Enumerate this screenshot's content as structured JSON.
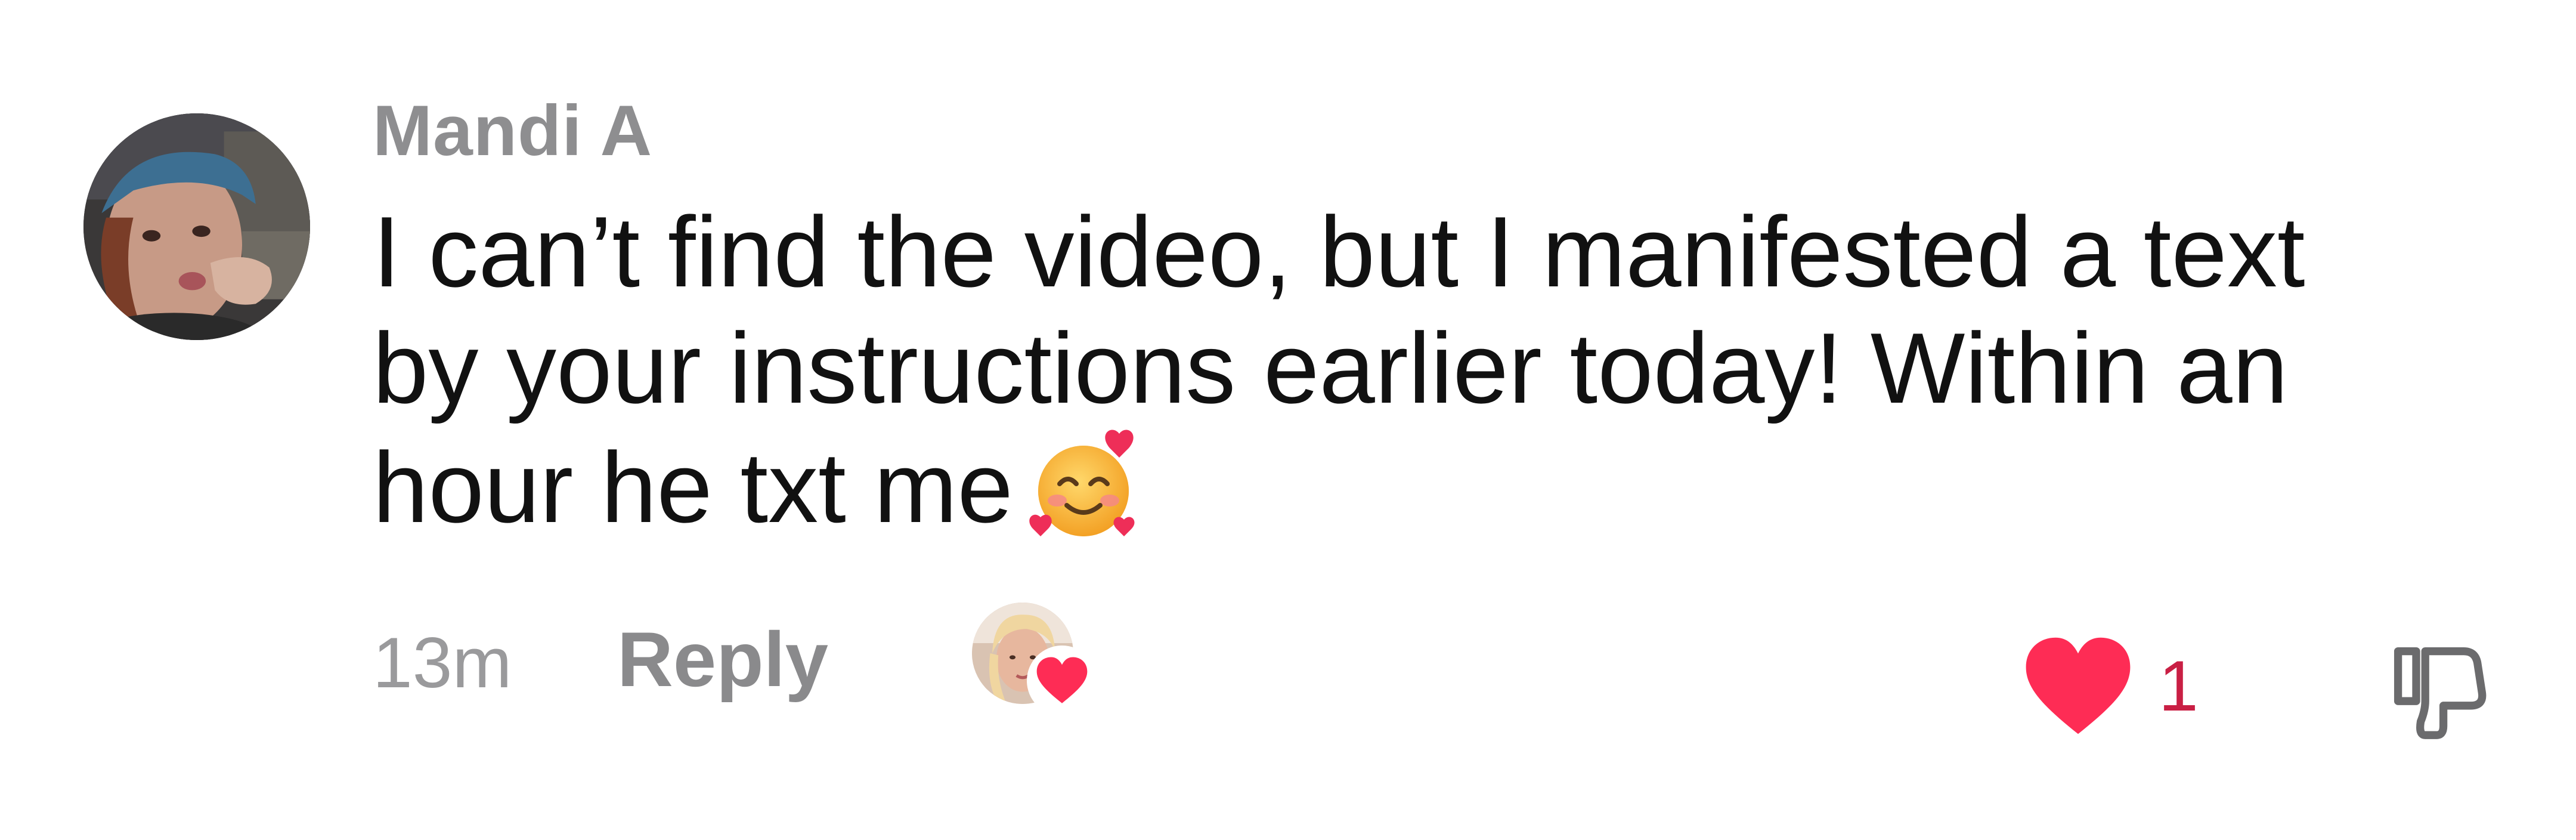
{
  "comment": {
    "username": "Mandi A",
    "text_lines": [
      "I can’t find the video, but I manifested a text",
      "by your instructions earlier today! Within an",
      "hour he txt me"
    ],
    "emoji": "smiling-face-with-hearts",
    "timestamp": "13m",
    "reply_label": "Reply",
    "like_count": "1",
    "creator_liked": true
  },
  "colors": {
    "like_red": "#fe2c55",
    "like_count_color": "#c91f44",
    "username_gray": "#8e8e90",
    "meta_gray": "#9a9a9c"
  },
  "icons": {
    "like": "heart-icon",
    "dislike": "thumbs-down-icon",
    "creator_badge": "heart-icon"
  }
}
